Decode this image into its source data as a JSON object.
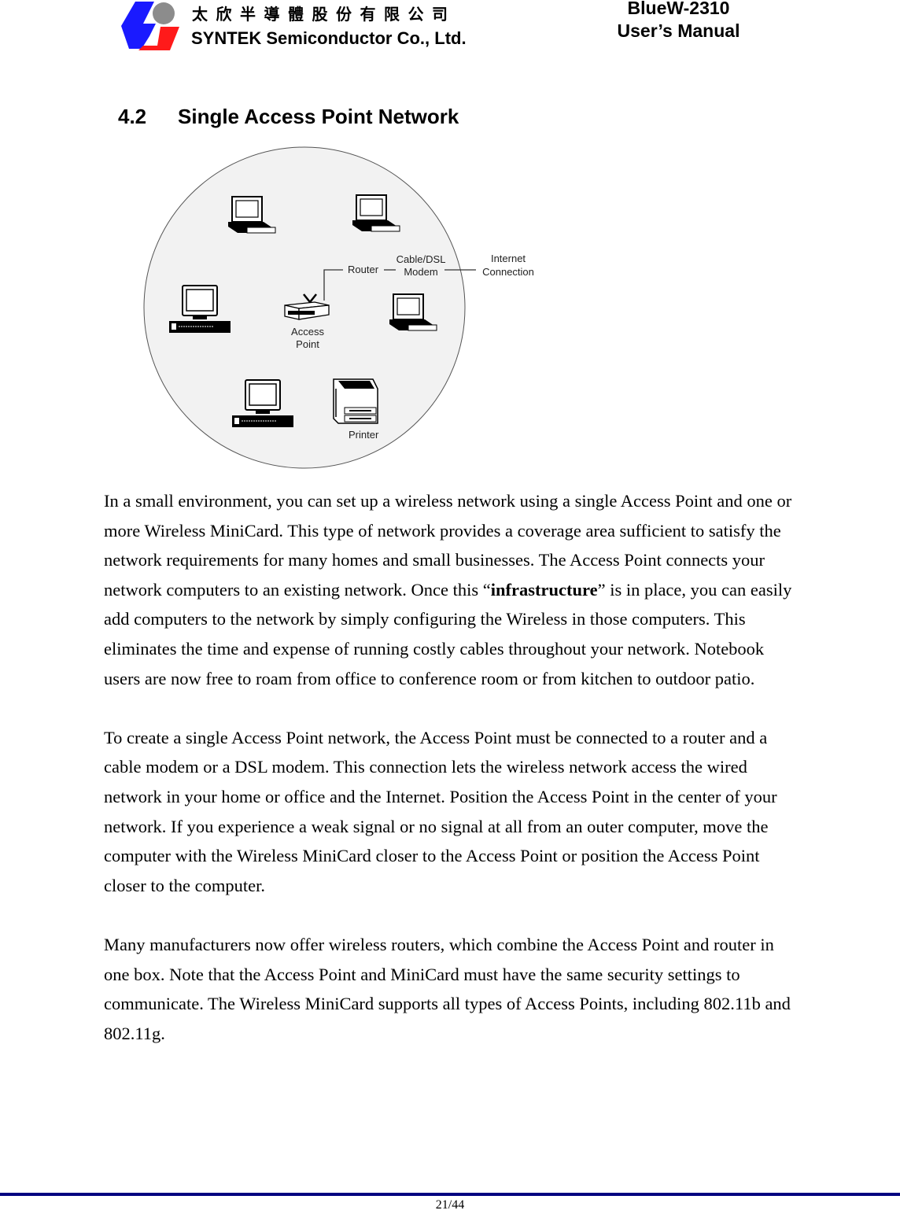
{
  "header": {
    "company_name_cn": "太欣半導體股份有限公司",
    "company_name_en": "SYNTEK Semiconductor Co., Ltd.",
    "product": "BlueW-2310",
    "doc_title": "User’s Manual",
    "logo_colors": {
      "blue": "#1a1aff",
      "red": "#ff1a1a",
      "gray": "#8c8c8c"
    }
  },
  "section": {
    "number": "4.2",
    "title": "Single Access Point Network"
  },
  "diagram": {
    "labels": {
      "router": "Router",
      "modem_line1": "Cable/DSL",
      "modem_line2": "Modem",
      "internet_line1": "Internet",
      "internet_line2": "Connection",
      "ap_line1": "Access",
      "ap_line2": "Point",
      "printer": "Printer"
    },
    "devices": [
      "laptop",
      "laptop",
      "desktop",
      "access-point",
      "laptop",
      "desktop",
      "printer"
    ],
    "circle_fill": "#f2f2f2"
  },
  "body": {
    "paragraphs": [
      {
        "before": "In a small environment, you can set up a wireless network using a single Access Point and one or more Wireless MiniCard. This type of network provides a coverage area sufficient to satisfy the network requirements for many homes and small businesses. The Access Point connects your network computers to an existing network. Once this “",
        "bold": "infrastructure",
        "after": "” is in place, you can easily add computers to the network by simply configuring the Wireless in those computers. This eliminates the time and expense of running costly cables throughout your network. Notebook users are now free to roam from office to conference room or from kitchen to outdoor patio."
      },
      {
        "text": "To create a single Access Point network, the Access Point must be connected to a router and a cable modem or a DSL modem. This connection lets the wireless network access the wired network in your home or office and the Internet. Position the Access Point in the center of your network. If you experience a weak signal or no signal at all from an outer computer, move the computer with the Wireless MiniCard closer to the Access Point or position the Access Point closer to the computer."
      },
      {
        "text": "Many manufacturers now offer wireless routers, which combine the Access Point and router in one box. Note that the Access Point and MiniCard must have the same security settings to communicate. The Wireless MiniCard supports all types of Access Points, including 802.11b and 802.11g."
      }
    ]
  },
  "footer": {
    "page": "21/44",
    "rule_color": "#000080"
  }
}
